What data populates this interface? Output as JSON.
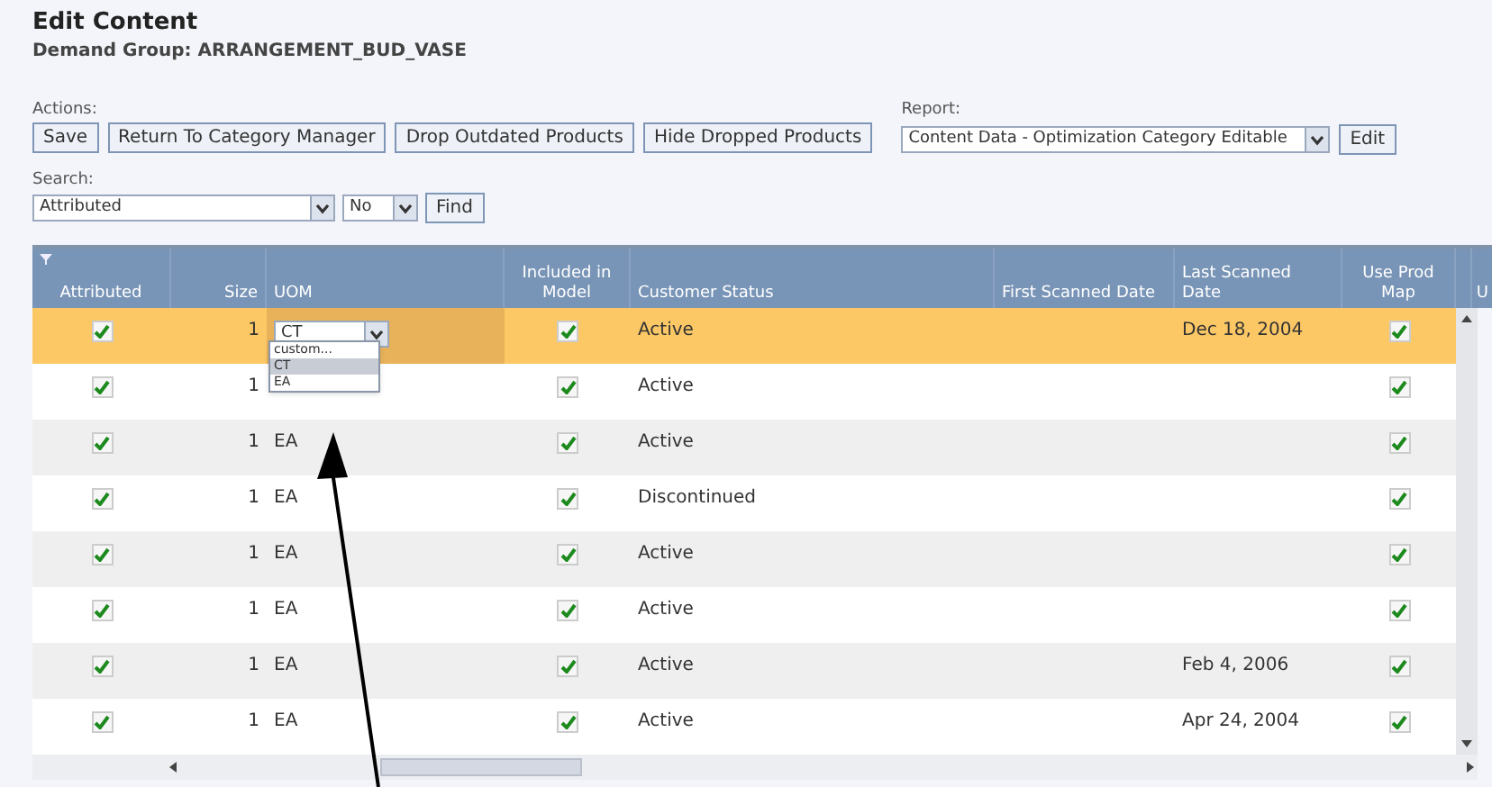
{
  "page": {
    "title": "Edit Content",
    "subtitle": "Demand Group: ARRANGEMENT_BUD_VASE"
  },
  "actions": {
    "label": "Actions:",
    "buttons": [
      "Save",
      "Return To Category Manager",
      "Drop Outdated Products",
      "Hide Dropped Products"
    ]
  },
  "report": {
    "label": "Report:",
    "value": "Content Data - Optimization Category Editable",
    "button": "Edit"
  },
  "search": {
    "label": "Search:",
    "field": "Attributed",
    "operator": "No",
    "button": "Find"
  },
  "table": {
    "columns": [
      "Attributed",
      "Size",
      "UOM",
      "Included in Model",
      "Customer Status",
      "First Scanned Date",
      "Last Scanned Date",
      "Use Prod Map",
      "U"
    ],
    "rows": [
      {
        "selected": true,
        "attributed": true,
        "size": "1",
        "uom": {
          "kind": "dropdown",
          "value": "CT"
        },
        "included": true,
        "status": "Active",
        "last": "Dec 18, 2004",
        "use_prod_map": true
      },
      {
        "selected": false,
        "attributed": true,
        "size": "1",
        "included": true,
        "status": "Active",
        "use_prod_map": true
      },
      {
        "selected": false,
        "attributed": true,
        "size": "1",
        "uom": {
          "kind": "text",
          "value": "EA"
        },
        "included": true,
        "status": "Active",
        "use_prod_map": true
      },
      {
        "selected": false,
        "attributed": true,
        "size": "1",
        "uom": {
          "kind": "text",
          "value": "EA"
        },
        "included": true,
        "status": "Discontinued",
        "use_prod_map": true
      },
      {
        "selected": false,
        "attributed": true,
        "size": "1",
        "uom": {
          "kind": "text",
          "value": "EA"
        },
        "included": true,
        "status": "Active",
        "use_prod_map": true
      },
      {
        "selected": false,
        "attributed": true,
        "size": "1",
        "uom": {
          "kind": "text",
          "value": "EA"
        },
        "included": true,
        "status": "Active",
        "use_prod_map": true
      },
      {
        "selected": false,
        "attributed": true,
        "size": "1",
        "uom": {
          "kind": "text",
          "value": "EA"
        },
        "included": true,
        "status": "Active",
        "last": "Feb 4, 2006",
        "use_prod_map": true
      },
      {
        "selected": false,
        "attributed": true,
        "size": "1",
        "uom": {
          "kind": "text",
          "value": "EA"
        },
        "included": true,
        "status": "Active",
        "last": "Apr 24, 2004",
        "use_prod_map": true
      }
    ]
  },
  "uom_dropdown": {
    "options": [
      {
        "label": "custom...",
        "selected": false
      },
      {
        "label": "CT",
        "selected": true
      },
      {
        "label": "EA",
        "selected": false
      }
    ]
  }
}
